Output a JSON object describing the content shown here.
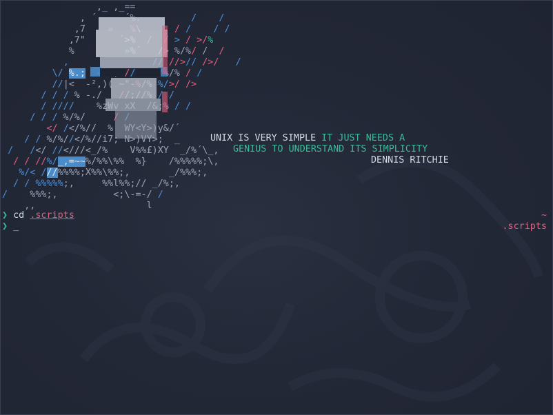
{
  "quote": {
    "line1_white": "UNIX IS VERY SIMPLE",
    "line1_teal": "IT JUST NEEDS A",
    "line2_teal": "GENIUS TO UNDERSTAND ITS SIMPLICITY",
    "author": "DENNIS RITCHIE"
  },
  "prompt": {
    "symbol": "❯",
    "command": "cd",
    "argument": ".scripts",
    "cursor": "_"
  },
  "right_prompt": {
    "home": "~",
    "current_dir": ".scripts"
  },
  "colors": {
    "background": "#232837",
    "accent_pink": "#e0607e",
    "accent_teal": "#3fb99a",
    "accent_blue": "#4a8cc9",
    "text": "#d5dae5"
  },
  "art": {
    "portrait": "ascii-portrait-dennis-ritchie"
  }
}
